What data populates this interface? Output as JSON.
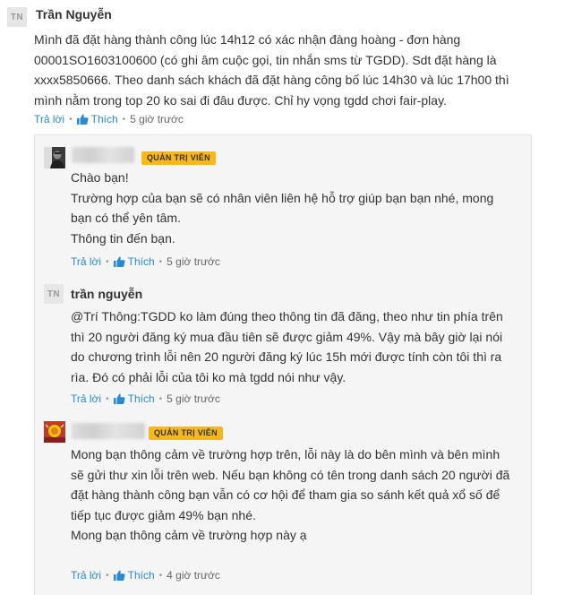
{
  "comment": {
    "avatar_initials": "TN",
    "author": "Trần Nguyễn",
    "lines": [
      "Mình đã đặt hàng thành công lúc 14h12 có xác nhận đàng hoàng - đơn hàng",
      "00001SO1603100600 (có ghi âm cuộc gọi, tin nhắn sms từ TGDD). Sdt đặt hàng là",
      "xxxx5850666. Theo danh sách khách đã đặt hàng công bố lúc 14h30 và lúc 17h00 thì",
      "mình nằm trong top 20 ko sai đi đâu được. Chỉ hy vọng tgdd chơi fair-play."
    ],
    "reply_label": "Trả lời",
    "like_label": "Thích",
    "separator": "•",
    "time": "5 giờ trước"
  },
  "replies": [
    {
      "badge": "QUẢN TRỊ VIÊN",
      "lines": [
        "Chào bạn!",
        "Trường hợp của bạn sẽ có nhân viên liên hệ hỗ trợ giúp bạn bạn nhé, mong",
        "bạn có thể yên tâm.",
        "Thông tin đến bạn."
      ],
      "reply_label": "Trả lời",
      "like_label": "Thích",
      "separator": "•",
      "time": "5 giờ trước"
    },
    {
      "avatar_initials": "TN",
      "author": "trần nguyễn",
      "lines": [
        "@Trí Thông:TGDD ko làm đúng theo thông tin đã đăng, theo như tin phía trên",
        "thì 20 người đăng ký mua đầu tiên sẽ được giảm 49%. Vậy mà bây giờ lại nói",
        "do chương trình lỗi nên 20 người đăng ký lúc 15h mới được tính còn tôi thì ra",
        "rìa. Đó có phải lỗi của tôi ko mà tgdd nói như vậy."
      ],
      "reply_label": "Trả lời",
      "like_label": "Thích",
      "separator": "•",
      "time": "5 giờ trước"
    },
    {
      "badge": "QUẢN TRỊ VIÊN",
      "lines": [
        "Mong bạn thông cảm về trường hợp trên, lỗi này là do bên mình và bên mình",
        "sẽ gửi thư xin lỗi trên web. Nếu bạn không có tên trong danh sách 20 người đã",
        "đặt hàng thành công bạn vẫn có cơ hội để tham gia so sánh kết quả xổ số để",
        "tiếp tục được giảm 49% bạn nhé.",
        "Mong bạn thông cảm về trường hợp này ạ"
      ],
      "reply_label": "Trả lời",
      "like_label": "Thích",
      "separator": "•",
      "time": "4 giờ trước"
    }
  ],
  "colors": {
    "link": "#288ad6",
    "badge": "#f8b81c",
    "reply_box_bg": "#f5f5f5"
  }
}
